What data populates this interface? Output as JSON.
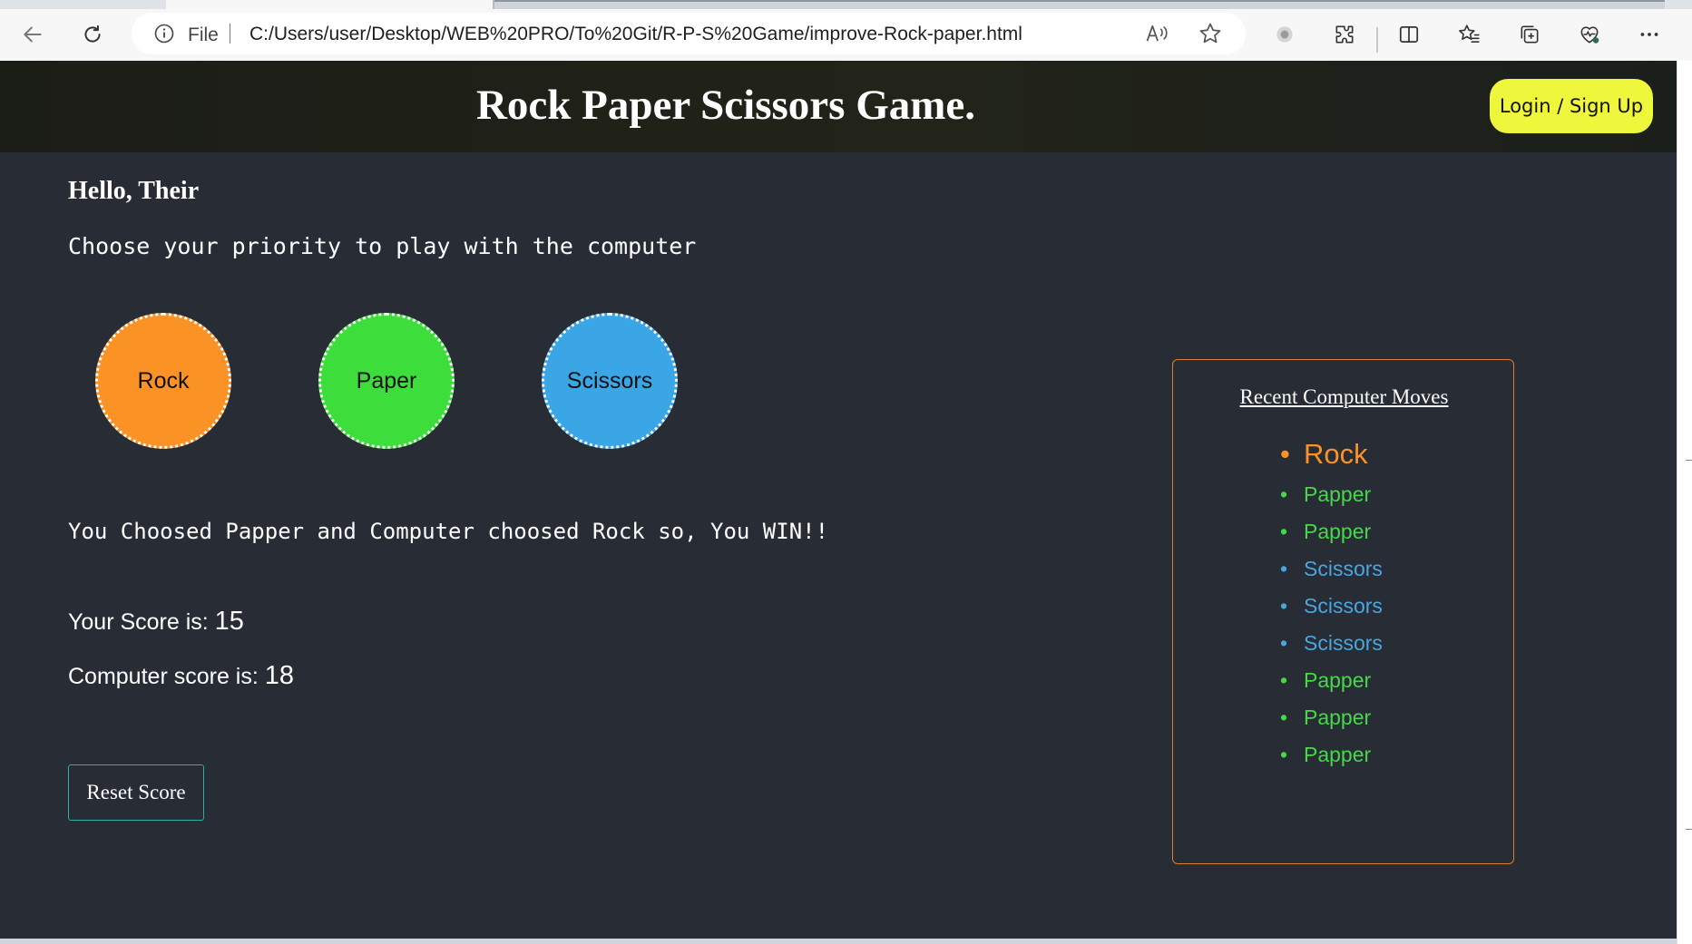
{
  "browser": {
    "address_prefix": "File",
    "url": "C:/Users/user/Desktop/WEB%20PRO/To%20Git/R-P-S%20Game/improve-Rock-paper.html",
    "icons": [
      "back-arrow-icon",
      "refresh-icon",
      "info-icon",
      "read-aloud-icon",
      "favorite-star-icon",
      "extension-record-icon",
      "extensions-puzzle-icon",
      "split-screen-icon",
      "favorites-icon",
      "collections-icon",
      "browser-essentials-icon",
      "more-options-icon"
    ]
  },
  "header": {
    "title": "Rock Paper Scissors Game.",
    "login_label": "Login / Sign Up"
  },
  "main": {
    "greeting": "Hello, Their",
    "instruction": "Choose your priority to play with the computer",
    "choices": [
      {
        "label": "Rock",
        "color": "#fb9226"
      },
      {
        "label": "Paper",
        "color": "#3ddd3c"
      },
      {
        "label": "Scissors",
        "color": "#3ba6e6"
      }
    ],
    "result": "You Choosed Papper and Computer choosed Rock so, You WIN!!",
    "score_label": "Your Score is:",
    "score_value": "15",
    "computer_score_label": "Computer score is:",
    "computer_score_value": "18",
    "reset_label": "Reset Score"
  },
  "moves": {
    "title": "Recent Computer Moves",
    "items": [
      {
        "label": "Rock",
        "color": "#fb9226"
      },
      {
        "label": "Papper",
        "color": "#45d94a"
      },
      {
        "label": "Papper",
        "color": "#45d94a"
      },
      {
        "label": "Scissors",
        "color": "#49a6e0"
      },
      {
        "label": "Scissors",
        "color": "#49a6e0"
      },
      {
        "label": "Scissors",
        "color": "#49a6e0"
      },
      {
        "label": "Papper",
        "color": "#45d94a"
      },
      {
        "label": "Papper",
        "color": "#45d94a"
      },
      {
        "label": "Papper",
        "color": "#45d94a"
      }
    ]
  },
  "colors": {
    "page_background": "#272c35",
    "login_button": "#eef73b",
    "panel_border": "#d9822b",
    "reset_border": "#29b0a0"
  }
}
